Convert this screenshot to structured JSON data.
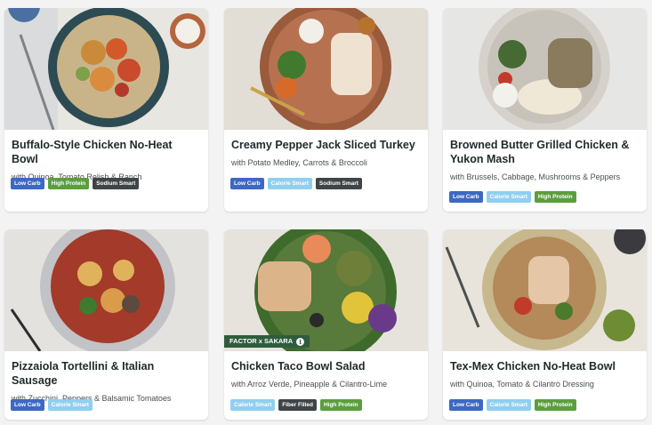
{
  "meals": [
    {
      "title": "Buffalo-Style Chicken No-Heat Bowl",
      "subtitle": "with Quinoa, Tomato Relish & Ranch",
      "tags": [
        "Low Carb",
        "High Protein",
        "Sodium Smart"
      ]
    },
    {
      "title": "Creamy Pepper Jack Sliced Turkey",
      "subtitle": "with Potato Medley, Carrots & Broccoli",
      "tags": [
        "Low Carb",
        "Calorie Smart",
        "Sodium Smart"
      ]
    },
    {
      "title": "Browned Butter Grilled Chicken & Yukon Mash",
      "subtitle": "with Brussels, Cabbage, Mushrooms & Peppers",
      "tags": [
        "Low Carb",
        "Calorie Smart",
        "High Protein"
      ]
    },
    {
      "title": "Pizzaiola Tortellini & Italian Sausage",
      "subtitle": "with Zucchini, Peppers & Balsamic Tomatoes",
      "tags": [
        "Low Carb",
        "Calorie Smart"
      ]
    },
    {
      "title": "Chicken Taco Bowl Salad",
      "subtitle": "with Arroz Verde, Pineapple & Cilantro-Lime",
      "tags": [
        "Calorie Smart",
        "Fiber Filled",
        "High Protein"
      ],
      "badge": "FACTOR x SAKARA"
    },
    {
      "title": "Tex-Mex Chicken No-Heat Bowl",
      "subtitle": "with Quinoa, Tomato & Cilantro Dressing",
      "tags": [
        "Low Carb",
        "Calorie Smart",
        "High Protein"
      ]
    }
  ],
  "tag_colors": {
    "Low Carb": "#3d68c4",
    "High Protein": "#5b9e3d",
    "Sodium Smart": "#3f4547",
    "Calorie Smart": "#90cfef",
    "Fiber Filled": "#3f4547"
  }
}
